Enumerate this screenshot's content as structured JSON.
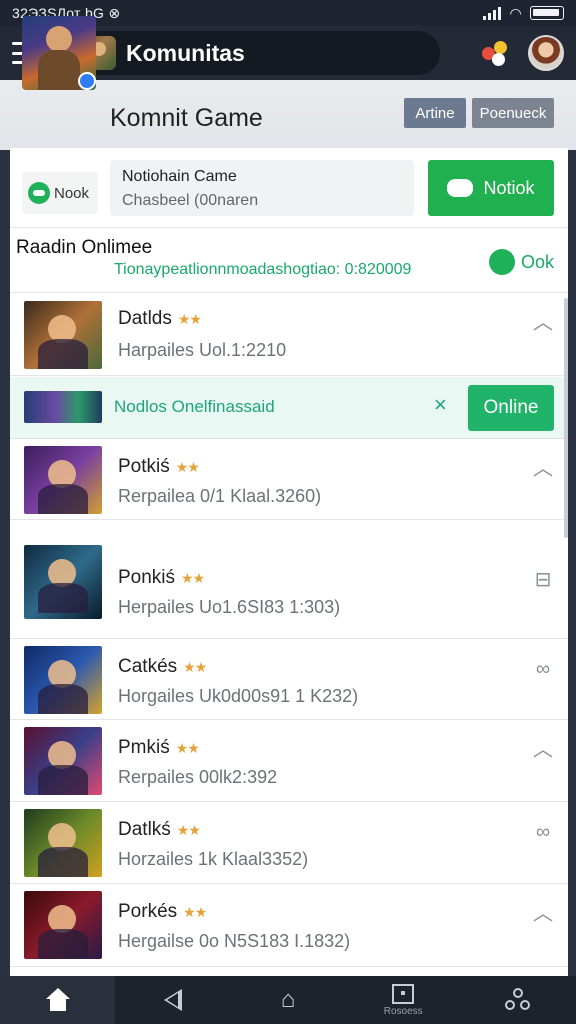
{
  "status_bar": {
    "left_text": "32ЭЗSЛот bG ⊗"
  },
  "app_bar": {
    "title": "Komunitas"
  },
  "community": {
    "title": "Komnit Game",
    "chips": [
      "Artine",
      "Poenueck"
    ]
  },
  "notification": {
    "tag": "Nook",
    "line1": "Notiohain Came",
    "line2": "Chasbeel (00naren",
    "button_label": "Notiok"
  },
  "online_section": {
    "title": "Raadin Onlimee",
    "subtitle": "Tionaypeatlionnmoadashogtiao: 0:820009",
    "ok_label": "Ook"
  },
  "promo": {
    "text": "Nodlos Onelfinassaid",
    "close_icon": "×",
    "button_label": "Online"
  },
  "games": [
    {
      "title": "Datlds",
      "subtitle": "Harpailes Uol.1:2210",
      "action": "chevron-up"
    },
    {
      "title": "Potkiś",
      "subtitle": "Rerpailea 0/1 Klaal.3260)",
      "action": "chevron-up"
    },
    {
      "title": "Ponkiś",
      "subtitle": "Herpailes Uo1.6SI83 1:303)",
      "action": "lock"
    },
    {
      "title": "Catkés",
      "subtitle": "Horgailes Uk0d00s91 1 K232)",
      "action": "link"
    },
    {
      "title": "Pmkiś",
      "subtitle": "Rerpailes 00lk2:392",
      "action": "chevron-up"
    },
    {
      "title": "Datlkś",
      "subtitle": "Horzailes 1k Klaal3352)",
      "action": "link"
    },
    {
      "title": "Porkés",
      "subtitle": "Hergailse 0o N5S183 I.1832)",
      "action": "chevron-up"
    }
  ],
  "stars_text": "★★",
  "bottom_nav": {
    "item4_label": "Rosoess"
  },
  "colors": {
    "accent_green": "#20b04f",
    "app_bar": "#232a36",
    "promo_bg": "#eaf8f3"
  }
}
